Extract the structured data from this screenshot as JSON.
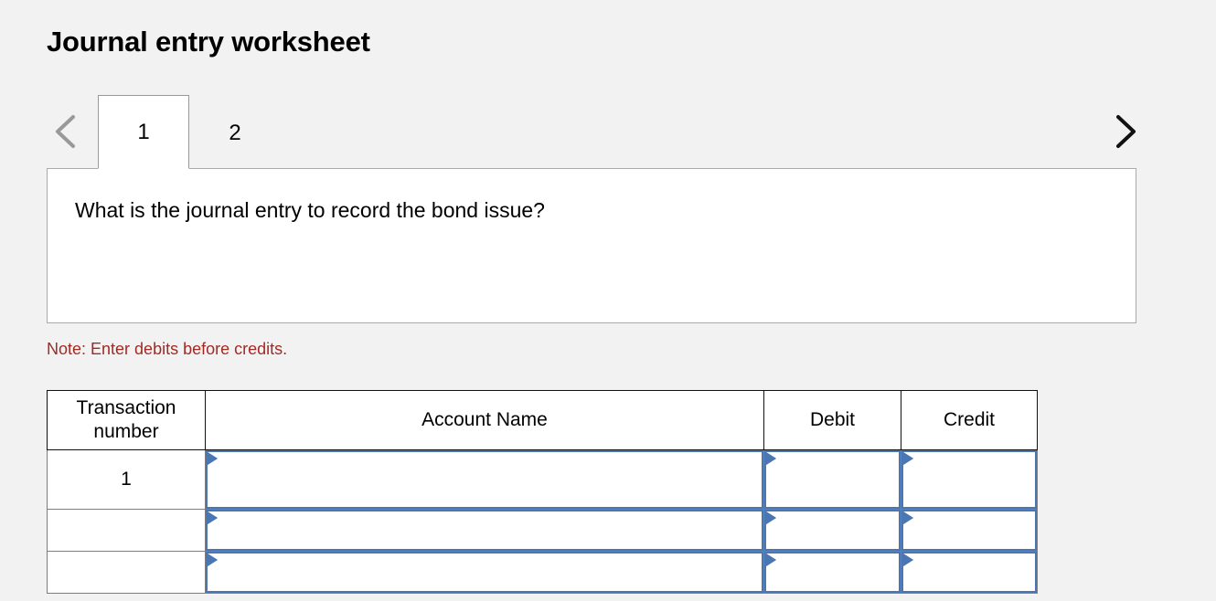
{
  "page": {
    "title": "Journal entry worksheet",
    "background_color": "#f2f2f2"
  },
  "navigator": {
    "prev_icon": "chevron-left-icon",
    "next_icon": "chevron-right-icon",
    "prev_enabled": false,
    "next_enabled": true,
    "prev_color": "#999999",
    "next_color": "#111111",
    "active_tab_index": 0,
    "tabs": [
      {
        "label": "1",
        "active": true
      },
      {
        "label": "2",
        "active": false
      }
    ]
  },
  "question": {
    "text": "What is the journal entry to record the bond issue?"
  },
  "note": {
    "text": "Note: Enter debits before credits.",
    "color": "#a22a25"
  },
  "table": {
    "headers": {
      "transaction_number": "Transaction number",
      "account_name": "Account Name",
      "debit": "Debit",
      "credit": "Credit"
    },
    "field_border_color": "#4a76b4",
    "rows": [
      {
        "transaction_number": "1",
        "account_name": "",
        "debit": "",
        "credit": "",
        "height": "tall"
      },
      {
        "transaction_number": "",
        "account_name": "",
        "debit": "",
        "credit": "",
        "height": "short"
      },
      {
        "transaction_number": "",
        "account_name": "",
        "debit": "",
        "credit": "",
        "height": "short"
      }
    ]
  }
}
